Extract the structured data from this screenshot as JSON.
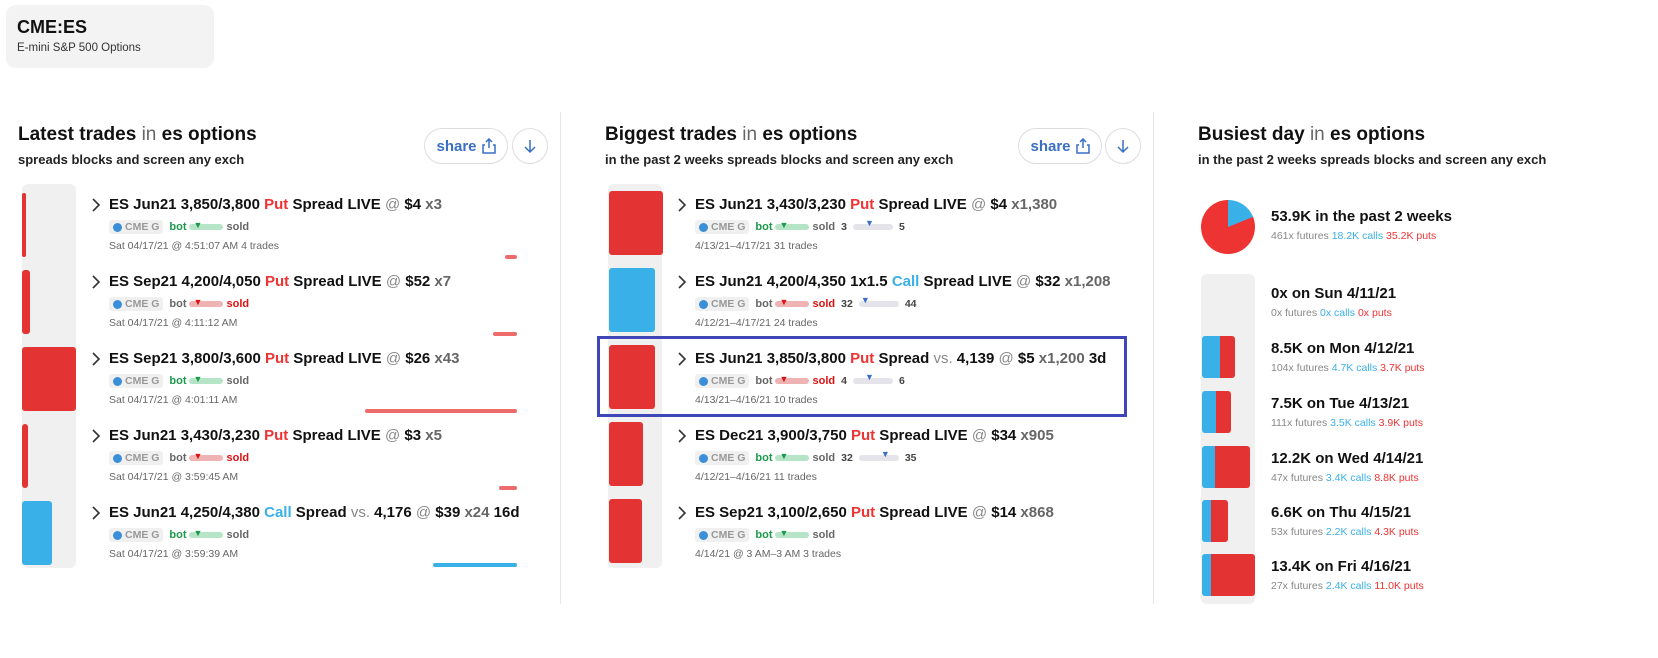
{
  "ticker": {
    "symbol": "CME:ES",
    "name": "E-mini S&P 500 Options"
  },
  "colors": {
    "put": "#e33333",
    "call": "#3ab0e8",
    "bot": "#1a9a4a",
    "accent": "#3a6fc4",
    "highlight": "#3f46b8"
  },
  "latest": {
    "title": "Latest trades",
    "in": "in",
    "scope": "es options",
    "subtitle": "spreads blocks and screen any exch",
    "share_label": "share",
    "trades": [
      {
        "main": "ES Jun21 3,850/3,800 ",
        "kind": "Put",
        "rest": " Spread LIVE ",
        "at": "@",
        "price": " $4",
        "qty": " x3",
        "exch": "CME G",
        "bot": "bot",
        "sold": "sold",
        "date": "Sat 04/17/21 @ 4:51:07 AM",
        "count": "4 trades",
        "bar_level": 0.08
      },
      {
        "main": "ES Sep21 4,200/4,050 ",
        "kind": "Put",
        "rest": " Spread LIVE ",
        "at": "@",
        "price": " $52",
        "qty": " x7",
        "exch": "CME G",
        "bot": "bot",
        "sold": "sold",
        "date": "Sat 04/17/21 @ 4:11:12 AM",
        "count": "",
        "bar_level": 0.16
      },
      {
        "main": "ES Sep21 3,800/3,600 ",
        "kind": "Put",
        "rest": " Spread LIVE ",
        "at": "@",
        "price": " $26",
        "qty": " x43",
        "exch": "CME G",
        "bot": "bot",
        "sold": "sold",
        "date": "Sat 04/17/21 @ 4:01:11 AM",
        "count": "",
        "bar_level": 1.0
      },
      {
        "main": "ES Jun21 3,430/3,230 ",
        "kind": "Put",
        "rest": " Spread LIVE ",
        "at": "@",
        "price": " $3",
        "qty": " x5",
        "exch": "CME G",
        "bot": "bot",
        "sold": "sold",
        "date": "Sat 04/17/21 @ 3:59:45 AM",
        "count": "",
        "bar_level": 0.12
      },
      {
        "main": "ES Jun21 4,250/4,380 ",
        "kind": "Call",
        "rest": " Spread ",
        "vs": "vs.",
        "vsval": " 4,176 ",
        "at": "@",
        "price": " $39",
        "qty": " x24",
        "extra": " 16d",
        "exch": "CME G",
        "bot": "bot",
        "sold": "sold",
        "date": "Sat 04/17/21 @ 3:59:39 AM",
        "count": "",
        "bar_level": 0.55
      }
    ]
  },
  "biggest": {
    "title": "Biggest trades",
    "in": "in",
    "scope": "es options",
    "subtitle": "in the past 2 weeks spreads blocks and screen any exch",
    "share_label": "share",
    "trades": [
      {
        "main": "ES Jun21 3,430/3,230 ",
        "kind": "Put",
        "rest": " Spread LIVE ",
        "at": "@",
        "price": " $4",
        "qty": " x1,380",
        "exch": "CME G",
        "bot": "bot",
        "sold": "sold",
        "lo": "3",
        "hi": "5",
        "date": "4/13/21–4/17/21",
        "count": "31 trades"
      },
      {
        "main": "ES Jun21 4,200/4,350 1x1.5 ",
        "kind": "Call",
        "rest": " Spread LIVE ",
        "at": "@",
        "price": " $32",
        "qty": " x1,208",
        "exch": "CME G",
        "bot": "bot",
        "sold": "sold",
        "lo": "32",
        "hi": "44",
        "date": "4/12/21–4/17/21",
        "count": "24 trades"
      },
      {
        "main": "ES Jun21 3,850/3,800 ",
        "kind": "Put",
        "rest": " Spread ",
        "vs": "vs.",
        "vsval": " 4,139 ",
        "at": "@",
        "price": " $5",
        "qty": " x1,200",
        "extra": " 3d",
        "exch": "CME G",
        "bot": "bot",
        "sold": "sold",
        "lo": "4",
        "hi": "6",
        "date": "4/13/21–4/16/21",
        "count": "10 trades"
      },
      {
        "main": "ES Dec21 3,900/3,750 ",
        "kind": "Put",
        "rest": " Spread LIVE ",
        "at": "@",
        "price": " $34",
        "qty": " x905",
        "exch": "CME G",
        "bot": "bot",
        "sold": "sold",
        "lo": "32",
        "hi": "35",
        "date": "4/12/21–4/16/21",
        "count": "11 trades"
      },
      {
        "main": "ES Sep21 3,100/2,650 ",
        "kind": "Put",
        "rest": " Spread LIVE ",
        "at": "@",
        "price": " $14",
        "qty": " x868",
        "exch": "CME G",
        "bot": "bot",
        "sold": "sold",
        "lo": "",
        "hi": "",
        "date": "4/14/21 @ 3 AM–3 AM",
        "count": "3 trades"
      }
    ]
  },
  "busiest": {
    "title": "Busiest day",
    "in": "in",
    "scope": "es options",
    "subtitle": "in the past 2 weeks spreads blocks and screen any exch",
    "summary": {
      "headline": "53.9K in the past 2 weeks",
      "futures": "461x futures",
      "calls": "18.2K calls",
      "puts": "35.2K puts",
      "call_share": 0.19
    },
    "days": [
      {
        "headline": "0x on Sun 4/11/21",
        "futures": "0x futures",
        "calls": "0x calls",
        "puts": "0x puts",
        "calls_k": 0,
        "puts_k": 0
      },
      {
        "headline": "8.5K on Mon 4/12/21",
        "futures": "104x futures",
        "calls": "4.7K calls",
        "puts": "3.7K puts",
        "calls_k": 4.7,
        "puts_k": 3.7
      },
      {
        "headline": "7.5K on Tue 4/13/21",
        "futures": "111x futures",
        "calls": "3.5K calls",
        "puts": "3.9K puts",
        "calls_k": 3.5,
        "puts_k": 3.9
      },
      {
        "headline": "12.2K on Wed 4/14/21",
        "futures": "47x futures",
        "calls": "3.4K calls",
        "puts": "8.8K puts",
        "calls_k": 3.4,
        "puts_k": 8.8
      },
      {
        "headline": "6.6K on Thu 4/15/21",
        "futures": "53x futures",
        "calls": "2.2K calls",
        "puts": "4.3K puts",
        "calls_k": 2.2,
        "puts_k": 4.3
      },
      {
        "headline": "13.4K on Fri 4/16/21",
        "futures": "27x futures",
        "calls": "2.4K calls",
        "puts": "11.0K puts",
        "calls_k": 2.4,
        "puts_k": 11.0
      }
    ]
  }
}
